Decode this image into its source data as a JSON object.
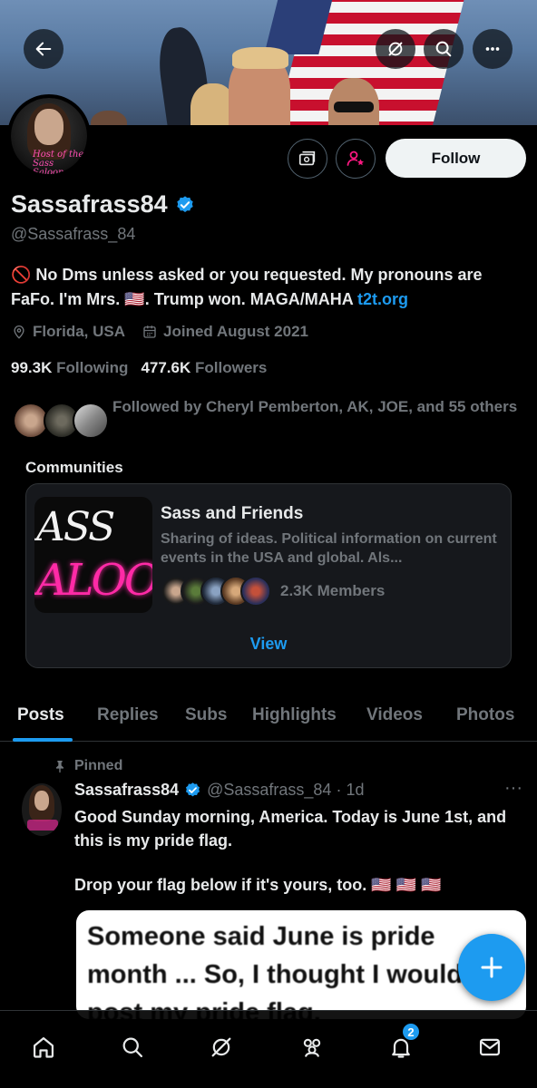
{
  "profile": {
    "name": "Sassafrass84",
    "handle": "@Sassafrass_84",
    "bio_prefix": "🚫 No Dms unless asked or you requested. My pronouns are FaFo. I'm Mrs. 🇺🇸. Trump won. MAGA/MAHA ",
    "bio_link": "t2t.org",
    "location": "Florida, USA",
    "joined": "Joined August 2021",
    "following_count": "99.3K",
    "following_label": "Following",
    "followers_count": "477.6K",
    "followers_label": "Followers",
    "followed_by": "Followed by Cheryl Pemberton, AK, JOE, and 55 others",
    "avatar_text_line1": "Host of the",
    "avatar_text_line2": "Sass Saloon"
  },
  "actions": {
    "follow_label": "Follow"
  },
  "communities": {
    "title": "Communities",
    "card": {
      "name": "Sass and Friends",
      "description": "Sharing of ideas. Political information on current events in the USA and global. Als...",
      "members": "2.3K Members",
      "view_label": "View",
      "image_text_1": "ASS",
      "image_text_2": "ALOO"
    }
  },
  "tabs": [
    {
      "label": "Posts",
      "active": true
    },
    {
      "label": "Replies"
    },
    {
      "label": "Subs"
    },
    {
      "label": "Highlights"
    },
    {
      "label": "Videos"
    },
    {
      "label": "Photos"
    }
  ],
  "post": {
    "pinned_label": "Pinned",
    "author_name": "Sassafrass84",
    "author_handle_time": "@Sassafrass_84 · 1d",
    "text_1": "Good Sunday morning, America. Today is June 1st, and this is my pride flag.",
    "text_2": "Drop your flag below if it's yours, too. 🇺🇸 🇺🇸 🇺🇸",
    "media_text": "Someone said June is pride month ... So, I thought I would post my pride flag."
  },
  "nav": {
    "notification_count": "2"
  },
  "colors": {
    "accent": "#1d9bf0",
    "background": "#000000",
    "muted": "#71767b",
    "pink": "#ff2aa6"
  }
}
